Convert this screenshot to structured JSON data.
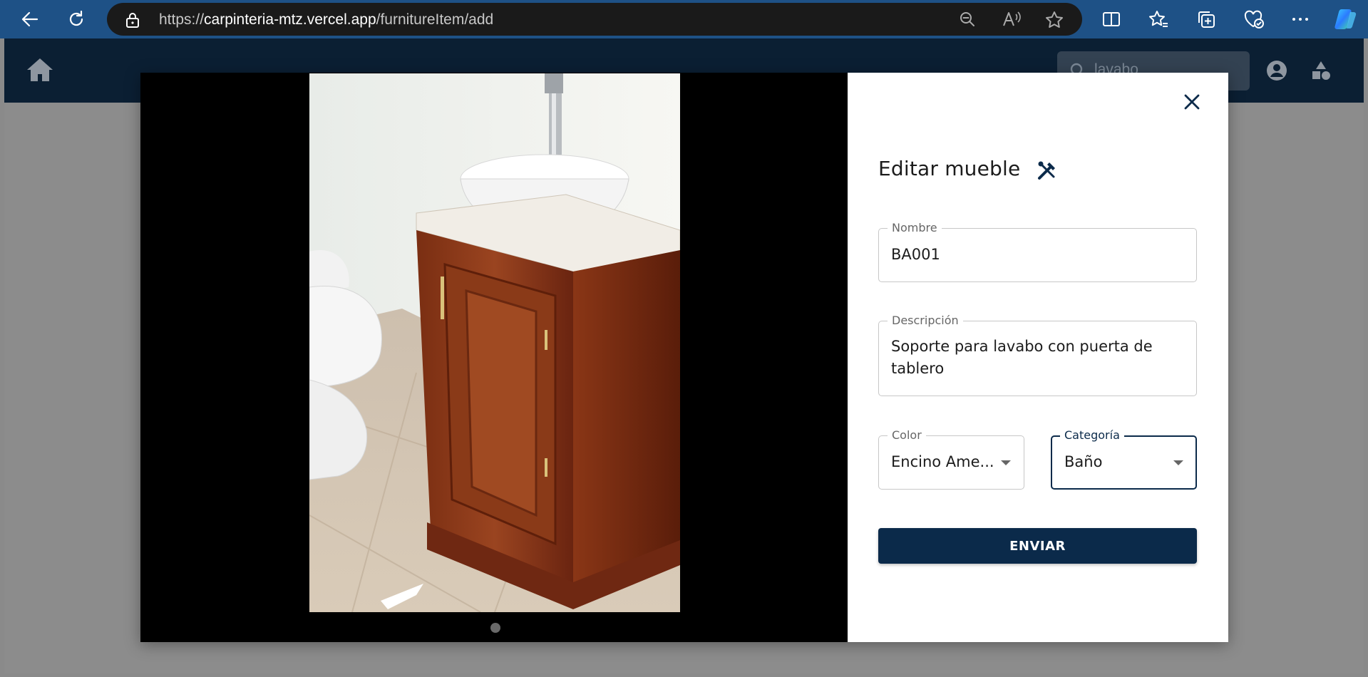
{
  "browser": {
    "url_scheme": "https://",
    "url_host": "carpinteria-mtz.vercel.app",
    "url_path": "/furnitureItem/add"
  },
  "app": {
    "search_value": "lavabo"
  },
  "modal": {
    "title": "Editar mueble",
    "nombre": {
      "label": "Nombre",
      "value": "BA001"
    },
    "descripcion": {
      "label": "Descripción",
      "value": "Soporte para lavabo con puerta de tablero"
    },
    "color": {
      "label": "Color",
      "value": "Encino Ame..."
    },
    "categoria": {
      "label": "Categoría",
      "value": "Baño"
    },
    "submit_label": "ENVIAR"
  },
  "colors": {
    "browser_bar": "#1e5186",
    "app_header": "#0b1f33",
    "primary": "#0b2a4a"
  }
}
